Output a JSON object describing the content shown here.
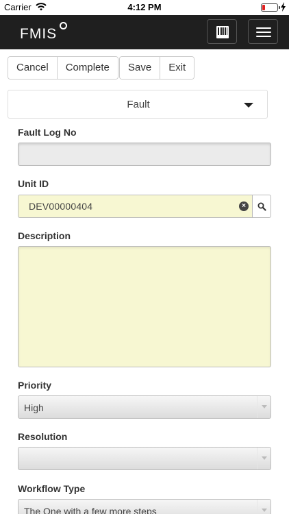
{
  "status_bar": {
    "carrier": "Carrier",
    "time": "4:12 PM",
    "battery_color": "#e02020"
  },
  "header": {
    "logo_text": "FMIS",
    "background": "#1f1f1f",
    "barcode_icon": "barcode-scan-icon",
    "menu_icon": "hamburger-menu-icon"
  },
  "toolbar": {
    "cancel_label": "Cancel",
    "complete_label": "Complete",
    "save_label": "Save",
    "exit_label": "Exit"
  },
  "type_select": {
    "value": "Fault"
  },
  "form": {
    "fault_log_no": {
      "label": "Fault Log No",
      "value": ""
    },
    "unit_id": {
      "label": "Unit ID",
      "value": "DEV00000404",
      "background": "#f7f7d2"
    },
    "description": {
      "label": "Description",
      "value": ""
    },
    "priority": {
      "label": "Priority",
      "value": "High"
    },
    "resolution": {
      "label": "Resolution",
      "value": ""
    },
    "workflow_type": {
      "label": "Workflow Type",
      "value": "The One with a few more steps"
    }
  }
}
